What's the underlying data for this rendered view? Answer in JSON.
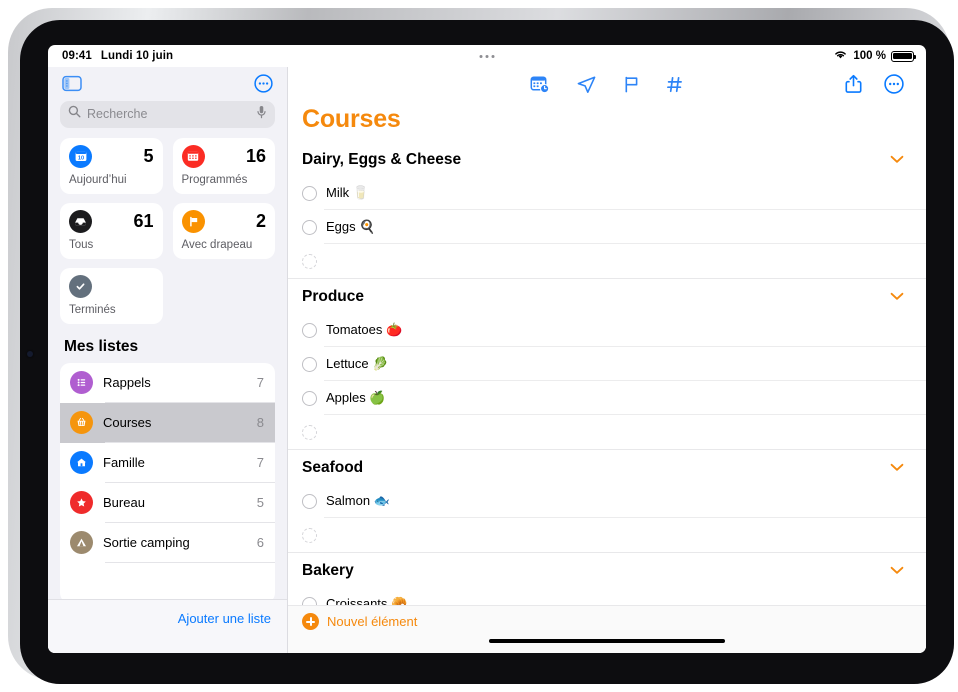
{
  "status_bar": {
    "time": "09:41",
    "date": "Lundi 10 juin",
    "wifi_icon": "wifi-icon",
    "battery_percent": "100 %",
    "battery_icon": "battery-full-icon"
  },
  "sidebar": {
    "toggle_icon": "sidebar-toggle-icon",
    "more_icon": "ellipsis-circle-icon",
    "search": {
      "placeholder": "Recherche",
      "value": "",
      "search_icon": "search-icon",
      "mic_icon": "microphone-icon"
    },
    "smart_lists": [
      {
        "label": "Aujourd’hui",
        "count": "5",
        "icon": "calendar-today-icon",
        "color": "#0a7aff"
      },
      {
        "label": "Programmés",
        "count": "16",
        "icon": "calendar-scheduled-icon",
        "color": "#fb2c24"
      },
      {
        "label": "Tous",
        "count": "61",
        "icon": "inbox-tray-icon",
        "color": "#1c1c1e"
      },
      {
        "label": "Avec drapeau",
        "count": "2",
        "icon": "flag-icon",
        "color": "#fa9200"
      },
      {
        "label": "Terminés",
        "count": "",
        "icon": "check-circle-icon",
        "color": "#63707d"
      }
    ],
    "my_lists_title": "Mes listes",
    "lists": [
      {
        "name": "Rappels",
        "count": "7",
        "icon": "list-bullet-icon",
        "color": "#b05ed0",
        "selected": false
      },
      {
        "name": "Courses",
        "count": "8",
        "icon": "shopping-basket-icon",
        "color": "#f5950d",
        "selected": true
      },
      {
        "name": "Famille",
        "count": "7",
        "icon": "house-icon",
        "color": "#0a7aff",
        "selected": false
      },
      {
        "name": "Bureau",
        "count": "5",
        "icon": "star-icon",
        "color": "#ef2b2b",
        "selected": false
      },
      {
        "name": "Sortie camping",
        "count": "6",
        "icon": "tent-icon",
        "color": "#9c8a6e",
        "selected": false
      }
    ],
    "add_list_label": "Ajouter une liste"
  },
  "main": {
    "toolbar_center_icons": [
      "calendar-clock-icon",
      "location-arrow-icon",
      "flag-outline-icon",
      "hashtag-icon"
    ],
    "toolbar_right_icons": [
      "share-icon",
      "ellipsis-circle-icon"
    ],
    "title": "Courses",
    "title_color": "#f5890d",
    "sections": [
      {
        "title": "Dairy, Eggs & Cheese",
        "chevron_icon": "chevron-down-icon",
        "items": [
          {
            "text": "Milk 🥛",
            "empty": false
          },
          {
            "text": "Eggs 🍳",
            "empty": false
          },
          {
            "text": "",
            "empty": true
          }
        ]
      },
      {
        "title": "Produce",
        "chevron_icon": "chevron-down-icon",
        "items": [
          {
            "text": "Tomatoes 🍅",
            "empty": false
          },
          {
            "text": "Lettuce 🥬",
            "empty": false
          },
          {
            "text": "Apples 🍏",
            "empty": false
          },
          {
            "text": "",
            "empty": true
          }
        ]
      },
      {
        "title": "Seafood",
        "chevron_icon": "chevron-down-icon",
        "items": [
          {
            "text": "Salmon 🐟",
            "empty": false
          },
          {
            "text": "",
            "empty": true
          }
        ]
      },
      {
        "title": "Bakery",
        "chevron_icon": "chevron-down-icon",
        "items": [
          {
            "text": "Croissants 🥐",
            "empty": false
          }
        ]
      }
    ],
    "new_item_label": "Nouvel élément",
    "new_item_icon": "plus-circle-icon"
  }
}
